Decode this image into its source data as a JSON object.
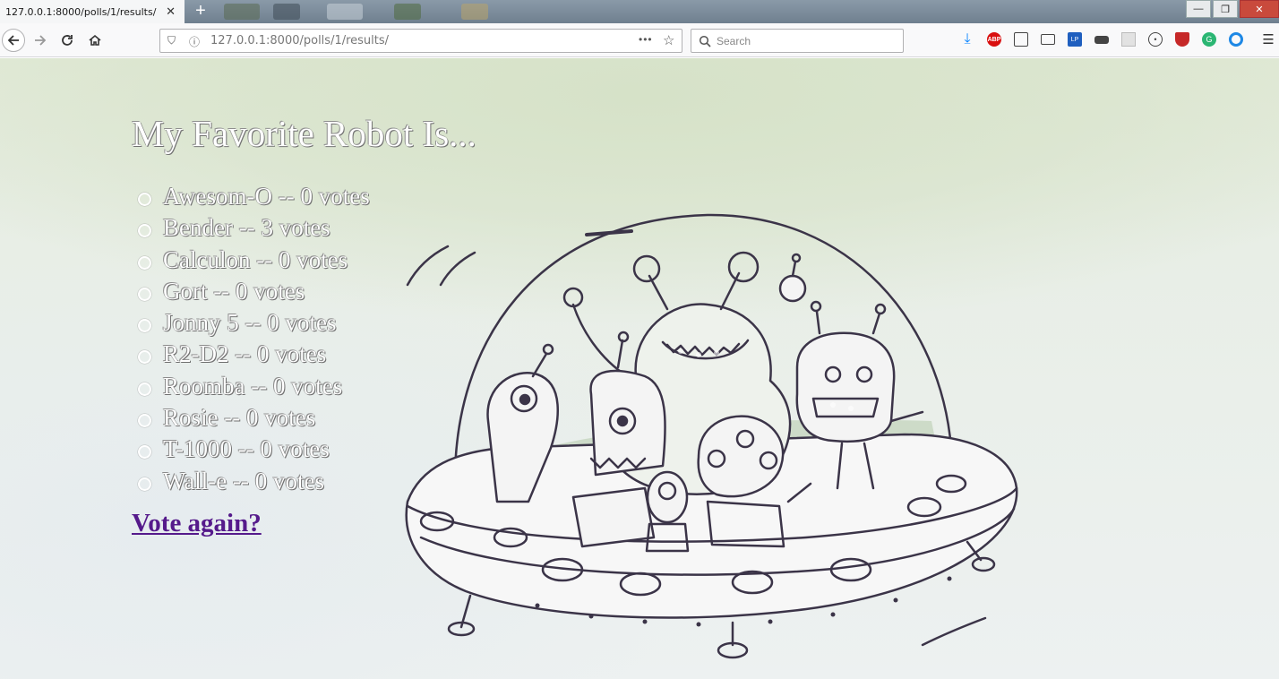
{
  "browser": {
    "tab_title": "127.0.0.1:8000/polls/1/results/",
    "url": "127.0.0.1:8000/polls/1/results/",
    "search_placeholder": "Search",
    "page_actions": "•••"
  },
  "poll": {
    "title": "My Favorite Robot Is...",
    "results": [
      {
        "label": "Awesom-O -- 0 votes"
      },
      {
        "label": "Bender -- 3 votes"
      },
      {
        "label": "Calculon -- 0 votes"
      },
      {
        "label": "Gort -- 0 votes"
      },
      {
        "label": "Jonny 5 -- 0 votes"
      },
      {
        "label": "R2-D2 -- 0 votes"
      },
      {
        "label": "Roomba -- 0 votes"
      },
      {
        "label": "Rosie -- 0 votes"
      },
      {
        "label": "T-1000 -- 0 votes"
      },
      {
        "label": "Wall-e -- 0 votes"
      }
    ],
    "vote_again": "Vote again?"
  },
  "colors": {
    "link_visited": "#551a8b",
    "download_icon": "#0a84ff",
    "abp_icon": "#d90f0f"
  }
}
